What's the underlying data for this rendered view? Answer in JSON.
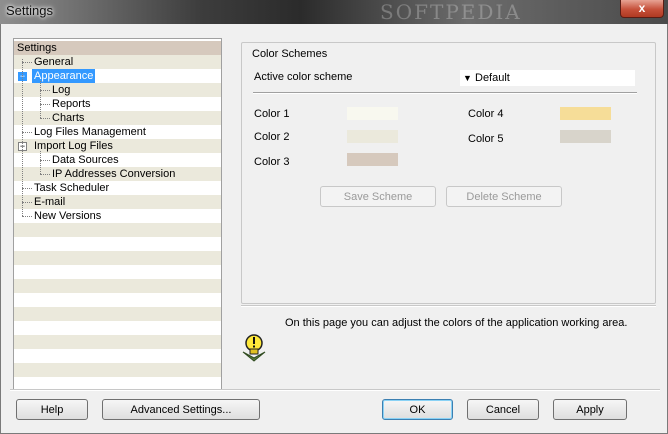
{
  "window": {
    "title": "Settings",
    "watermark": "SOFTPEDIA",
    "close_symbol": "x"
  },
  "tree": {
    "items": [
      {
        "label": "Settings"
      },
      {
        "label": "General"
      },
      {
        "label": "Appearance",
        "toggle": "−"
      },
      {
        "label": "Log"
      },
      {
        "label": "Reports"
      },
      {
        "label": "Charts"
      },
      {
        "label": "Log Files Management"
      },
      {
        "label": "Import Log Files",
        "toggle": "−"
      },
      {
        "label": "Data Sources"
      },
      {
        "label": "IP Addresses Conversion"
      },
      {
        "label": "Task Scheduler"
      },
      {
        "label": "E-mail"
      },
      {
        "label": "New Versions"
      }
    ]
  },
  "color_schemes": {
    "group_title": "Color Schemes",
    "active_label": "Active color scheme",
    "active_value": "Default",
    "colors": [
      {
        "label": "Color 1",
        "value": "#f8f8ef"
      },
      {
        "label": "Color 2",
        "value": "#ebe9dc"
      },
      {
        "label": "Color 3",
        "value": "#d6c9bd"
      },
      {
        "label": "Color 4",
        "value": "#f6dd98"
      },
      {
        "label": "Color 5",
        "value": "#d8d4cb"
      }
    ],
    "save_button": "Save Scheme",
    "delete_button": "Delete Scheme"
  },
  "info": {
    "text": "On this page you can adjust the colors of the application working area.",
    "icon": "lightbulb-info-icon"
  },
  "footer": {
    "help": "Help",
    "advanced": "Advanced Settings...",
    "ok": "OK",
    "cancel": "Cancel",
    "apply": "Apply"
  }
}
